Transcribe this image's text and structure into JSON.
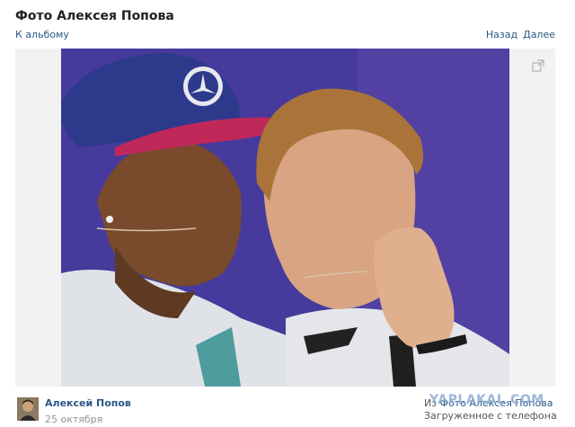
{
  "header": {
    "title": "Фото Алексея Попова",
    "back_link": "К альбому",
    "nav_back": "Назад",
    "nav_next": "Далее"
  },
  "photo": {
    "left_cap_color": "#2d3a8c",
    "left_cap_brim_color": "#c0285a",
    "background_color": "#4a3ca2"
  },
  "footer": {
    "author_name": "Алексей Попов",
    "date": "25 октября",
    "album_prefix": "Из",
    "album_link": "Фото Алексея Попова",
    "album_sub": "Загруженное с телефона",
    "watermark": "YAPLAKAL.COM"
  },
  "icons": {
    "expand": "expand-icon",
    "avatar": "avatar"
  }
}
